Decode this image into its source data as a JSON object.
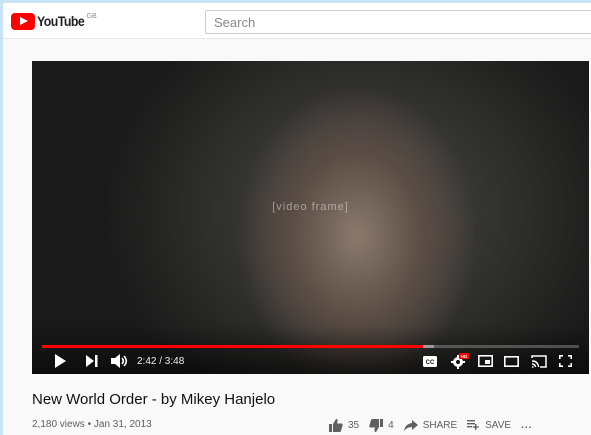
{
  "masthead": {
    "logo_text": "YouTube",
    "country_code": "GB",
    "search_placeholder": "Search"
  },
  "player": {
    "current_time": "2:42",
    "duration": "3:48",
    "time_display": "2:42 / 3:48",
    "progress_fraction": 0.71,
    "buffered_fraction": 0.73,
    "cc_label": "CC",
    "hd_badge": "HD",
    "accent_color": "#ff0000",
    "icons": {
      "play": "play-icon",
      "next": "next-icon",
      "volume": "volume-icon",
      "captions": "captions-icon",
      "settings": "settings-icon",
      "miniplayer": "miniplayer-icon",
      "theater": "theater-icon",
      "cast": "cast-icon",
      "fullscreen": "fullscreen-icon"
    }
  },
  "video": {
    "title": "New World Order - by Mikey Hanjelo",
    "views": "2,180 views",
    "separator": "•",
    "date": "Jan 31, 2013",
    "meta_line": "2,180 views • Jan 31, 2013"
  },
  "actions": {
    "like_count": "35",
    "dislike_count": "4",
    "share_label": "SHARE",
    "save_label": "SAVE",
    "more_label": "..."
  }
}
